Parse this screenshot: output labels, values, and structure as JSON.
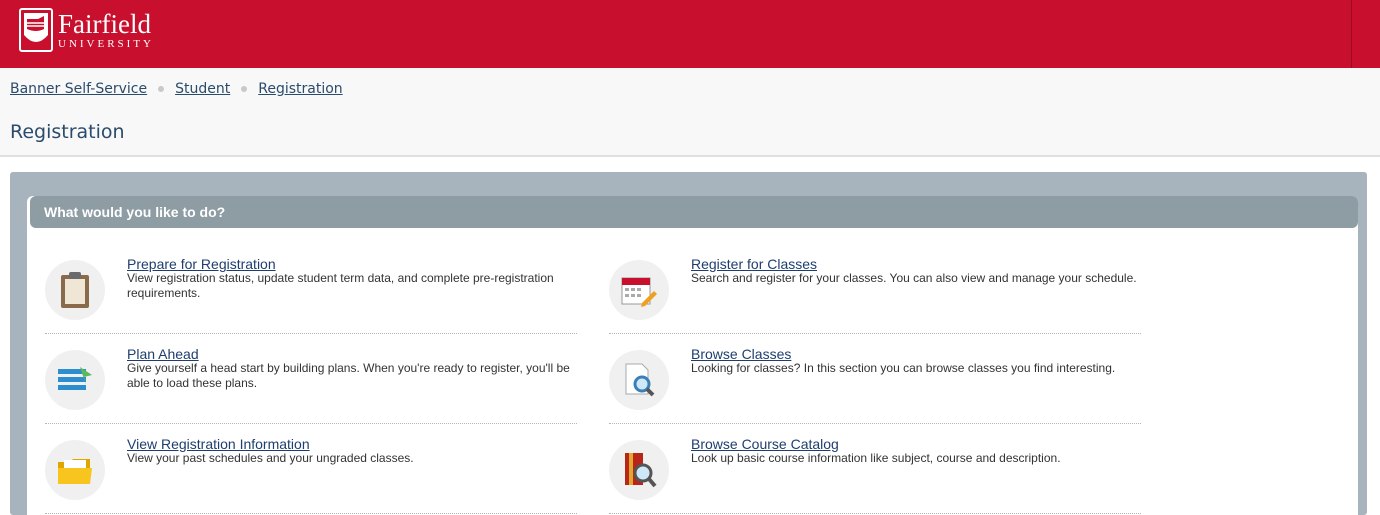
{
  "header": {
    "logo_name": "Fairfield",
    "logo_sub": "UNIVERSITY",
    "brand_color": "#c8102e"
  },
  "breadcrumbs": [
    {
      "label": "Banner Self-Service"
    },
    {
      "label": "Student"
    },
    {
      "label": "Registration"
    }
  ],
  "page_title": "Registration",
  "panel": {
    "header": "What would you like to do?"
  },
  "items": [
    {
      "title": "Prepare for Registration",
      "desc": "View registration status, update student term data, and complete pre-registration requirements.",
      "icon": "clipboard-icon"
    },
    {
      "title": "Register for Classes",
      "desc": "Search and register for your classes. You can also view and manage your schedule.",
      "icon": "calendar-icon"
    },
    {
      "title": "Plan Ahead",
      "desc": "Give yourself a head start by building plans. When you're ready to register, you'll be able to load these plans.",
      "icon": "plan-list-icon"
    },
    {
      "title": "Browse Classes",
      "desc": "Looking for classes? In this section you can browse classes you find interesting.",
      "icon": "document-search-icon"
    },
    {
      "title": "View Registration Information",
      "desc": "View your past schedules and your ungraded classes.",
      "icon": "folder-icon"
    },
    {
      "title": "Browse Course Catalog",
      "desc": "Look up basic course information like subject, course and description.",
      "icon": "catalog-search-icon"
    }
  ]
}
